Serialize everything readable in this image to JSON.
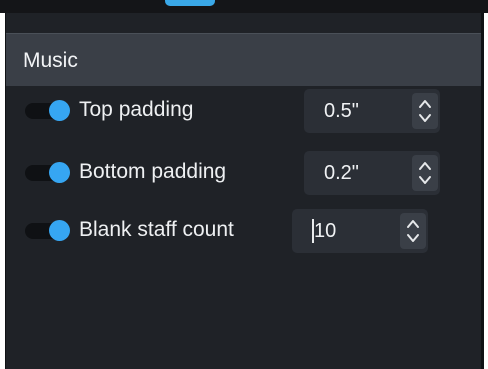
{
  "section": {
    "title": "Music"
  },
  "rows": [
    {
      "label": "Top padding",
      "value": "0.5\"",
      "toggle_on": true
    },
    {
      "label": "Bottom padding",
      "value": "0.2\"",
      "toggle_on": true
    },
    {
      "label": "Blank staff count",
      "value": "10",
      "toggle_on": true
    }
  ],
  "colors": {
    "accent": "#36a6f2",
    "panel_bg": "#1f2227",
    "header_bg": "#3a3f47"
  },
  "icons": {
    "spinner": "chevron-up-down-icon"
  }
}
